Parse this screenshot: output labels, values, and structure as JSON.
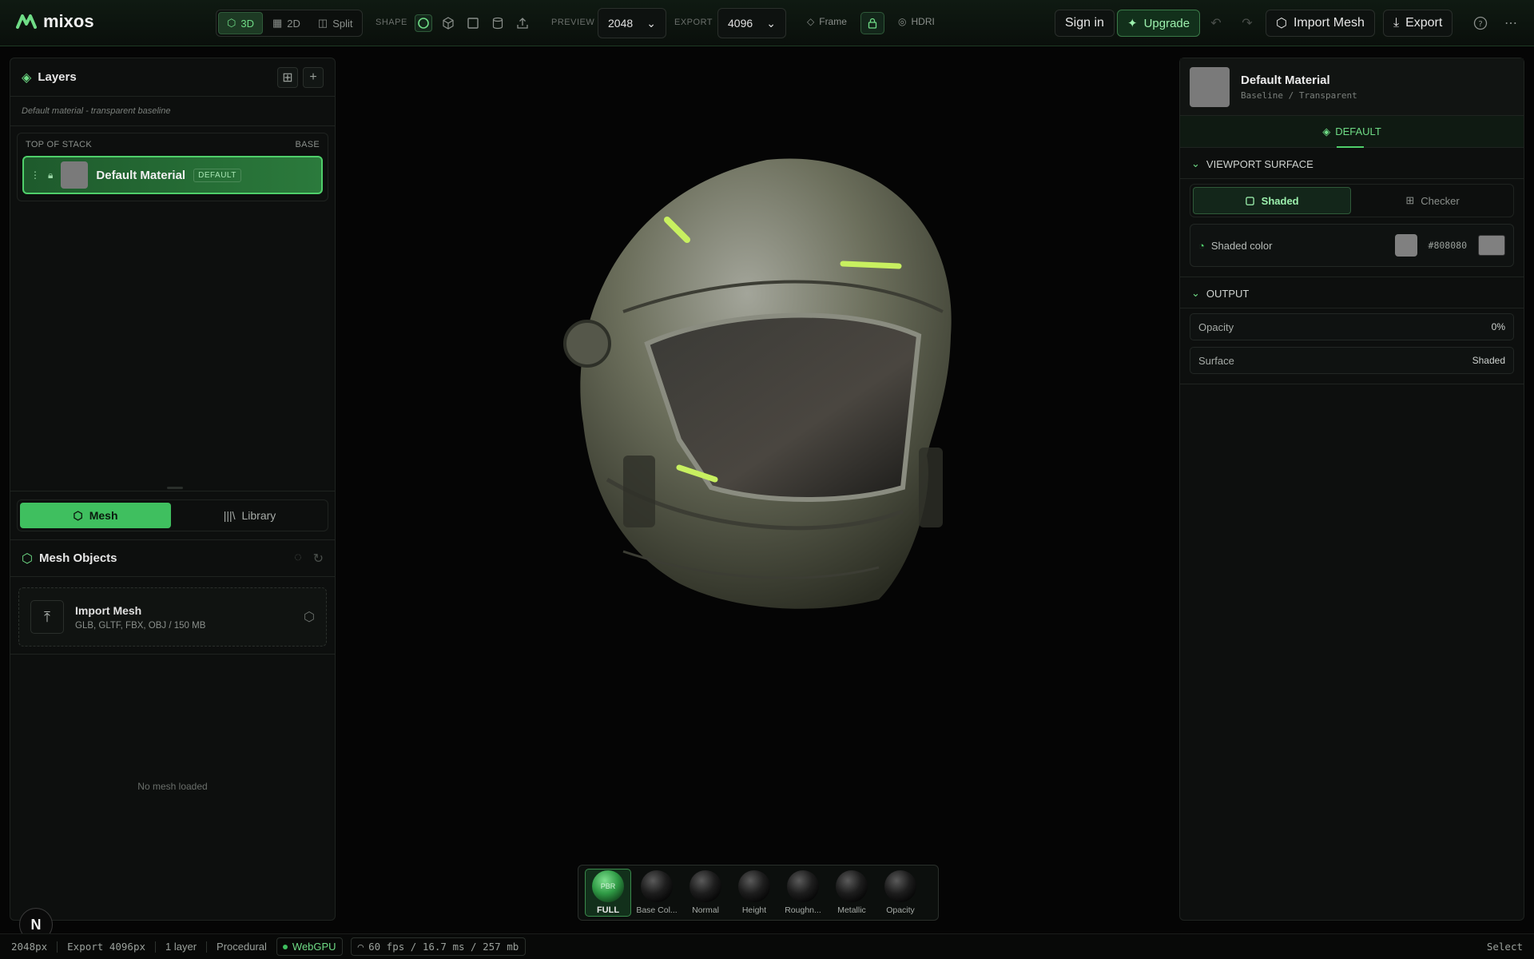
{
  "app": {
    "name": "mixos"
  },
  "toolbar": {
    "view_modes": [
      {
        "label": "3D",
        "active": true
      },
      {
        "label": "2D",
        "active": false
      },
      {
        "label": "Split",
        "active": false
      }
    ],
    "shape_label": "SHAPE",
    "preview_label": "PREVIEW",
    "preview_value": "2048",
    "export_label": "EXPORT",
    "export_value": "4096",
    "frame_label": "Frame",
    "hdri_label": "HDRI",
    "sign_in": "Sign in",
    "upgrade": "Upgrade",
    "import_mesh": "Import Mesh",
    "export": "Export"
  },
  "layers": {
    "title": "Layers",
    "subtitle": "Default material - transparent baseline",
    "stack_top": "TOP OF STACK",
    "stack_base": "BASE",
    "items": [
      {
        "name": "Default Material",
        "badge": "DEFAULT"
      }
    ]
  },
  "left_tabs": [
    {
      "label": "Mesh",
      "active": true
    },
    {
      "label": "Library",
      "active": false
    }
  ],
  "mesh_objects": {
    "title": "Mesh Objects",
    "import_title": "Import Mesh",
    "import_formats": "GLB, GLTF, FBX, OBJ / 150 MB",
    "empty_text": "No mesh loaded"
  },
  "channels": [
    {
      "label": "FULL",
      "badge": "PBR",
      "active": true
    },
    {
      "label": "Base Col...",
      "active": false
    },
    {
      "label": "Normal",
      "active": false
    },
    {
      "label": "Height",
      "active": false
    },
    {
      "label": "Roughn...",
      "active": false
    },
    {
      "label": "Metallic",
      "active": false
    },
    {
      "label": "Opacity",
      "active": false
    }
  ],
  "material": {
    "name": "Default Material",
    "subtitle": "Baseline / Transparent",
    "tab": "DEFAULT",
    "viewport_surface": {
      "title": "VIEWPORT SURFACE",
      "options": [
        {
          "label": "Shaded",
          "active": true
        },
        {
          "label": "Checker",
          "active": false
        }
      ],
      "shaded_color_label": "Shaded color",
      "shaded_color_value": "#808080"
    },
    "output": {
      "title": "OUTPUT",
      "opacity_label": "Opacity",
      "opacity_value": "0%",
      "surface_label": "Surface",
      "surface_value": "Shaded"
    }
  },
  "status": {
    "preview": "2048px",
    "export": "Export 4096px",
    "layers": "1 layer",
    "mode": "Procedural",
    "renderer": "WebGPU",
    "perf": "60 fps / 16.7 ms / 257 mb",
    "tool": "Select"
  },
  "colors": {
    "accent": "#3fbf5f",
    "background": "#050505",
    "panel": "#0d0f0e"
  }
}
